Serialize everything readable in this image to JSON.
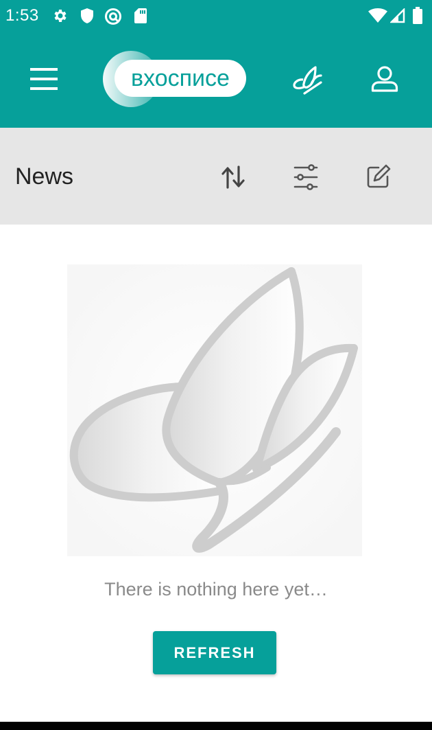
{
  "status_bar": {
    "time": "1:53",
    "icons": [
      "gear-icon",
      "shield-icon",
      "vpn-icon",
      "sd-card-icon",
      "wifi-icon",
      "signal-icon",
      "battery-icon"
    ]
  },
  "app_bar": {
    "logo_text": "вхосписе",
    "icons": [
      "menu-icon",
      "butterfly-icon",
      "profile-icon"
    ]
  },
  "toolbar": {
    "title": "News",
    "icons": [
      "sort-icon",
      "filter-icon",
      "edit-icon"
    ]
  },
  "empty_state": {
    "image": "butterfly-illustration",
    "message": "There is nothing here yet…",
    "button_label": "REFRESH"
  },
  "colors": {
    "primary": "#06a09a",
    "toolbar_bg": "#e6e6e6",
    "message_text": "#8a8a8a"
  }
}
